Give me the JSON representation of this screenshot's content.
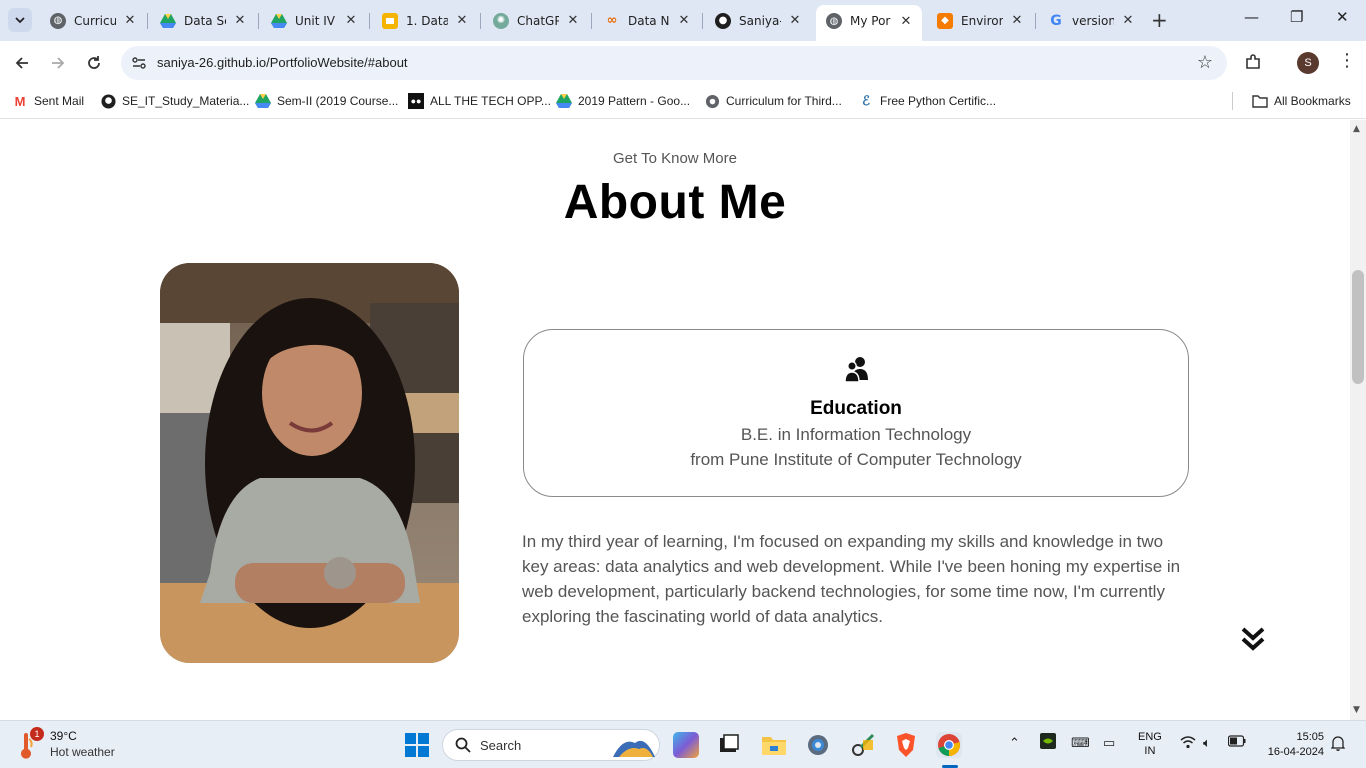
{
  "browser": {
    "tabs": [
      {
        "label": "Curricu",
        "icon": "globe-icon",
        "color": "#5f6368"
      },
      {
        "label": "Data Sc",
        "icon": "google-drive-icon",
        "color": "#1fa463"
      },
      {
        "label": "Unit IV",
        "icon": "google-drive-icon",
        "color": "#1fa463"
      },
      {
        "label": "1. Data",
        "icon": "google-slides-icon",
        "color": "#f4b400"
      },
      {
        "label": "ChatGP",
        "icon": "chatgpt-icon",
        "color": "#74aa9c"
      },
      {
        "label": "Data N",
        "icon": "colab-icon",
        "color": "#e8710a"
      },
      {
        "label": "Saniya-",
        "icon": "github-icon",
        "color": "#1f1f1f"
      },
      {
        "label": "My Por",
        "icon": "globe-icon",
        "color": "#5f6368",
        "active": true
      },
      {
        "label": "Enviror",
        "icon": "environment-icon",
        "color": "#f57c00"
      },
      {
        "label": "version",
        "icon": "google-icon",
        "color": "#4285f4"
      }
    ],
    "url": "saniya-26.github.io/PortfolioWebsite/#about",
    "profile_initial": "S"
  },
  "bookmarks": [
    {
      "label": "Sent Mail",
      "icon": "gmail-icon"
    },
    {
      "label": "SE_IT_Study_Materia...",
      "icon": "github-icon"
    },
    {
      "label": "Sem-II (2019 Course...",
      "icon": "google-drive-icon"
    },
    {
      "label": "ALL THE TECH OPP...",
      "icon": "medium-icon"
    },
    {
      "label": "2019 Pattern - Goo...",
      "icon": "google-drive-icon"
    },
    {
      "label": "Curriculum for Third...",
      "icon": "globe-icon"
    },
    {
      "label": "Free Python Certific...",
      "icon": "python-icon"
    },
    {
      "label": "All Bookmarks",
      "icon": "folder-icon"
    }
  ],
  "page": {
    "subtitle": "Get To Know More",
    "title": "About Me",
    "education": {
      "heading": "Education",
      "line1": "B.E. in Information Technology",
      "line2": "from Pune Institute of Computer Technology"
    },
    "about_text": "In my third year of learning, I'm focused on expanding my skills and knowledge in two key areas: data analytics and web development. While I've been honing my expertise in web development, particularly backend technologies, for some time now, I'm currently exploring the fascinating world of data analytics."
  },
  "taskbar": {
    "weather_badge": "1",
    "temperature": "39°C",
    "weather_condition": "Hot weather",
    "search_placeholder": "Search",
    "lang_line1": "ENG",
    "lang_line2": "IN",
    "time": "15:05",
    "date": "16-04-2024"
  }
}
